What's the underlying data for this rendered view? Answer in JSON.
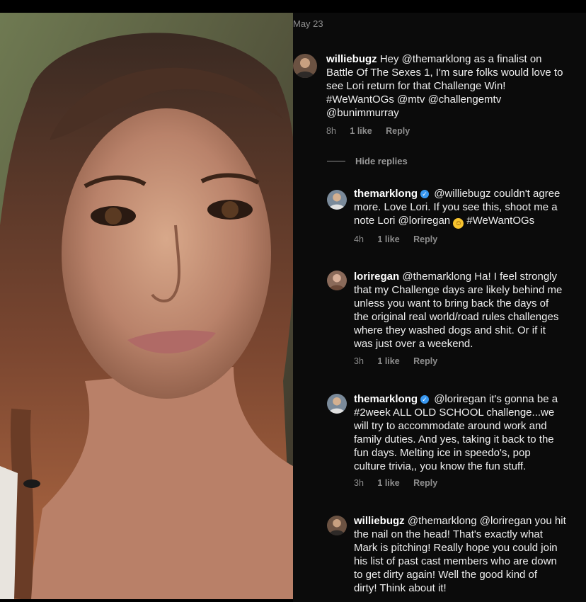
{
  "date": "May 23",
  "hide_replies": "Hide replies",
  "comments": [
    {
      "username": "williebugz",
      "lines": [
        "Hey @themarklong as a finalist on",
        "Battle Of The Sexes 1, I'm sure folks would love to",
        "see Lori return for that Challenge Win!",
        "#WeWantOGs @mtv @challengemtv",
        "@bunimmurray"
      ],
      "time": "8h",
      "likes": "1 like",
      "reply": "Reply"
    },
    {
      "username": "themarklong",
      "lines": [
        "@williebugz couldn't agree",
        "more. Love Lori. If you see this, shoot me a",
        "note Lori @loriregan",
        "#WeWantOGs"
      ],
      "time": "4h",
      "likes": "1 like",
      "reply": "Reply"
    },
    {
      "username": "loriregan",
      "lines": [
        "@themarklong Ha!  I feel strongly",
        "that my Challenge days are likely behind me",
        "unless you want to bring back the days of",
        "the original real world/road rules challenges",
        "where they washed dogs and shit.  Or if it",
        "was just over a weekend."
      ],
      "time": "3h",
      "likes": "1 like",
      "reply": "Reply"
    },
    {
      "username": "themarklong",
      "lines": [
        "@loriregan it's gonna be a",
        "#2week ALL OLD SCHOOL challenge...we",
        "will try to accommodate around work and",
        "family duties. And yes, taking it back to the",
        "fun days. Melting ice in speedo's, pop",
        "culture trivia,, you know the fun stuff."
      ],
      "time": "3h",
      "likes": "1 like",
      "reply": "Reply"
    },
    {
      "username": "williebugz",
      "lines": [
        "@themarklong @loriregan you hit",
        "the nail on the head! That's exactly what",
        "Mark is pitching! Really hope you could join",
        "his list of past cast members who are down",
        "to get dirty again! Well the good kind of",
        "dirty! Think about it!"
      ]
    }
  ],
  "colors": {
    "background": "#0b0b0b",
    "text": "#efefef",
    "muted": "#8e8e8e",
    "verified": "#3897f0"
  }
}
